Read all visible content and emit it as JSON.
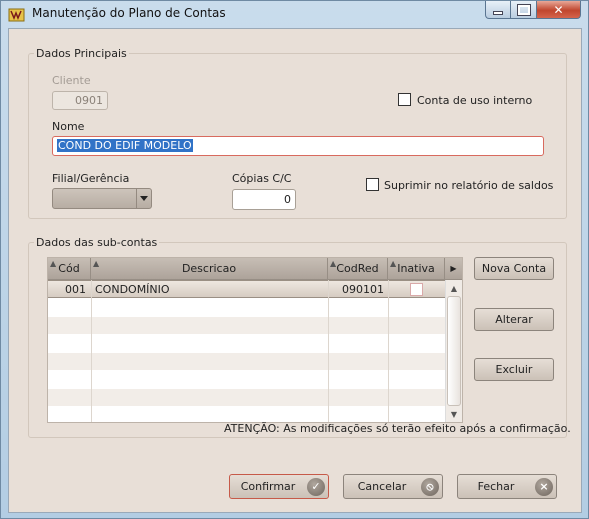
{
  "window": {
    "title": "Manutenção do Plano de Contas",
    "icon": "folder-app-icon",
    "controls": {
      "minimize": "minimize-icon",
      "maximize": "maximize-icon",
      "close": "✕"
    }
  },
  "principais": {
    "legend": "Dados Principais",
    "cliente_label": "Cliente",
    "cliente_value": "0901",
    "conta_uso_interno_label": "Conta de uso interno",
    "conta_uso_interno_checked": false,
    "nome_label": "Nome",
    "nome_value": "COND DO EDIF MODELO",
    "filial_label": "Filial/Gerência",
    "filial_value": "",
    "copias_label": "Cópias C/C",
    "copias_value": "0",
    "suprimir_label": "Suprimir no relatório de saldos",
    "suprimir_checked": false
  },
  "subcontas": {
    "legend": "Dados das sub-contas",
    "columns": [
      "Cód",
      "Descricao",
      "CodRed",
      "Inativa"
    ],
    "rows": [
      {
        "cod": "001",
        "descricao": "CONDOMÍNIO",
        "codred": "090101",
        "inativa": false
      }
    ],
    "buttons": {
      "nova": "Nova Conta",
      "alterar": "Alterar",
      "excluir": "Excluir"
    }
  },
  "notice": "ATENÇÃO: As modificações só terão efeito após a confirmação.",
  "footer": {
    "confirmar": "Confirmar",
    "cancelar": "Cancelar",
    "fechar": "Fechar"
  },
  "colors": {
    "accent_border": "#c65a49",
    "selection": "#3173c7",
    "panel": "#e8dfd7"
  }
}
